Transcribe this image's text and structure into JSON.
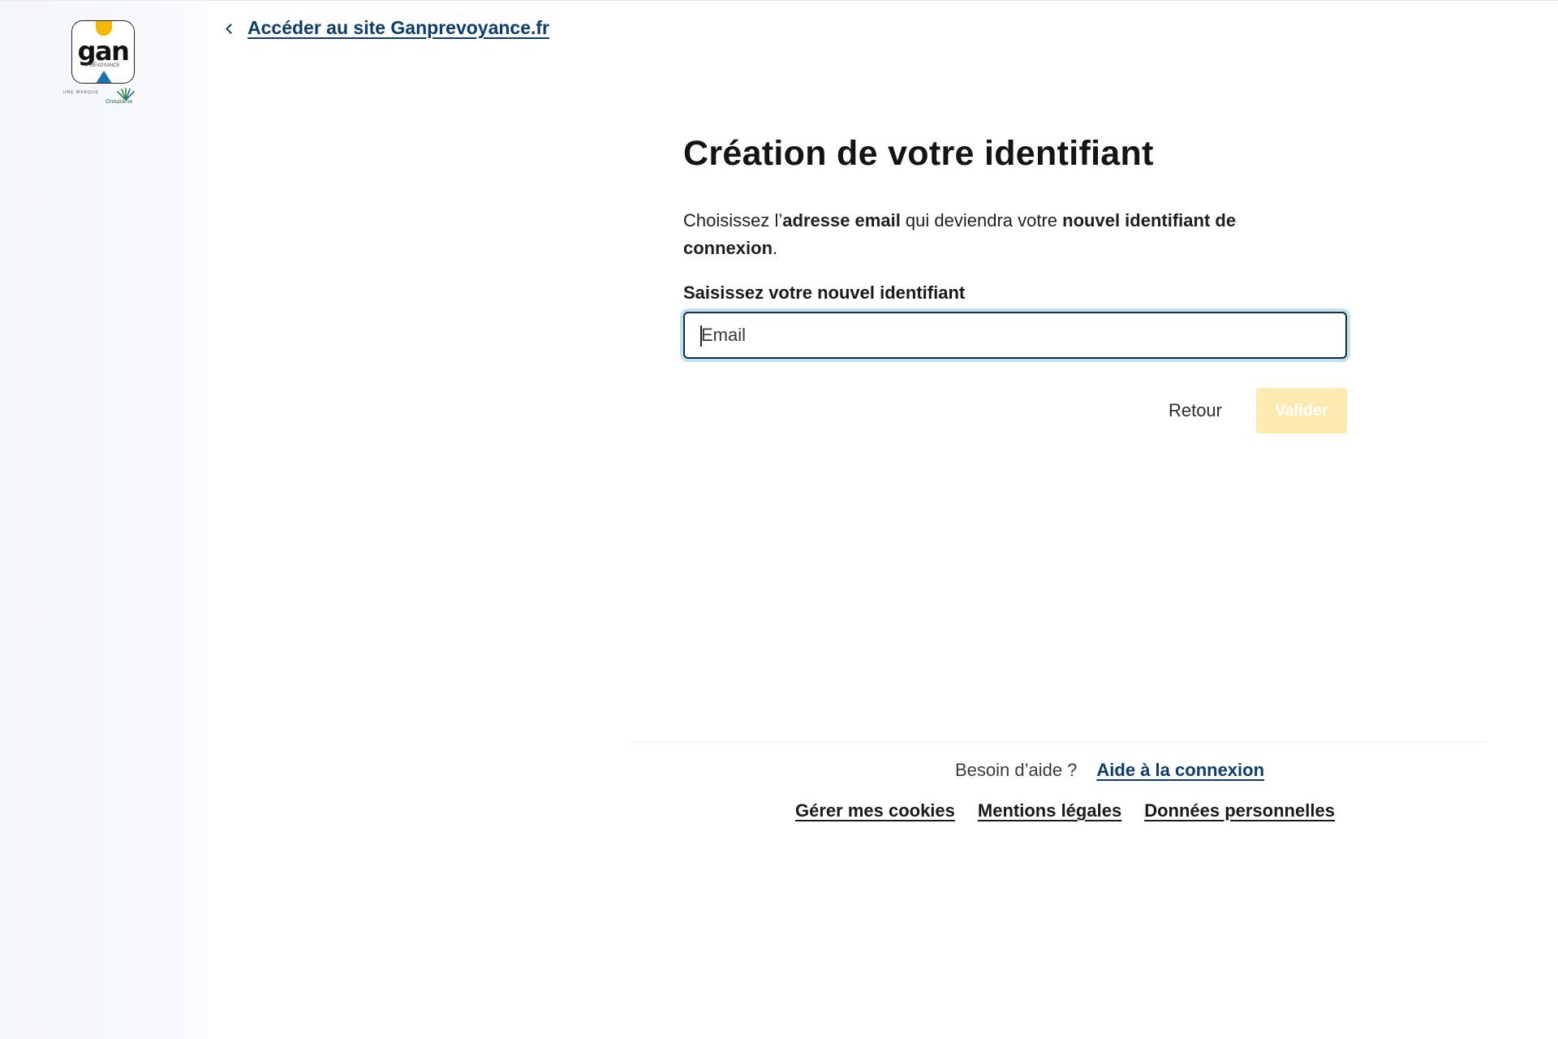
{
  "brand": {
    "logo_text": "gan",
    "logo_sub": "PRÉVOYANCE",
    "logo_foot": "UNE MARQUE",
    "parent_brand": "Groupama",
    "accent_yellow": "#f5b800",
    "accent_blue": "#1d6fb8",
    "link_color": "#0b3d6e"
  },
  "nav": {
    "back_link_label": "Accéder au site Ganprevoyance.fr",
    "back_icon": "chevron-left-icon"
  },
  "form": {
    "title": "Création de votre identifiant",
    "intro_part1": "Choisissez l’",
    "intro_bold1": "adresse email",
    "intro_part2": " qui deviendra votre ",
    "intro_bold2": "nouvel identifiant de connexion",
    "intro_part3": ".",
    "field_label": "Saisissez votre nouvel identifiant",
    "email_placeholder": "Email",
    "email_value": "",
    "back_button": "Retour",
    "submit_button": "Valider",
    "submit_disabled_color": "#fdeab0"
  },
  "footer": {
    "help_text": "Besoin d’aide ?",
    "help_link": "Aide à la connexion",
    "links": [
      "Gérer mes cookies",
      "Mentions légales",
      "Données personnelles"
    ]
  }
}
